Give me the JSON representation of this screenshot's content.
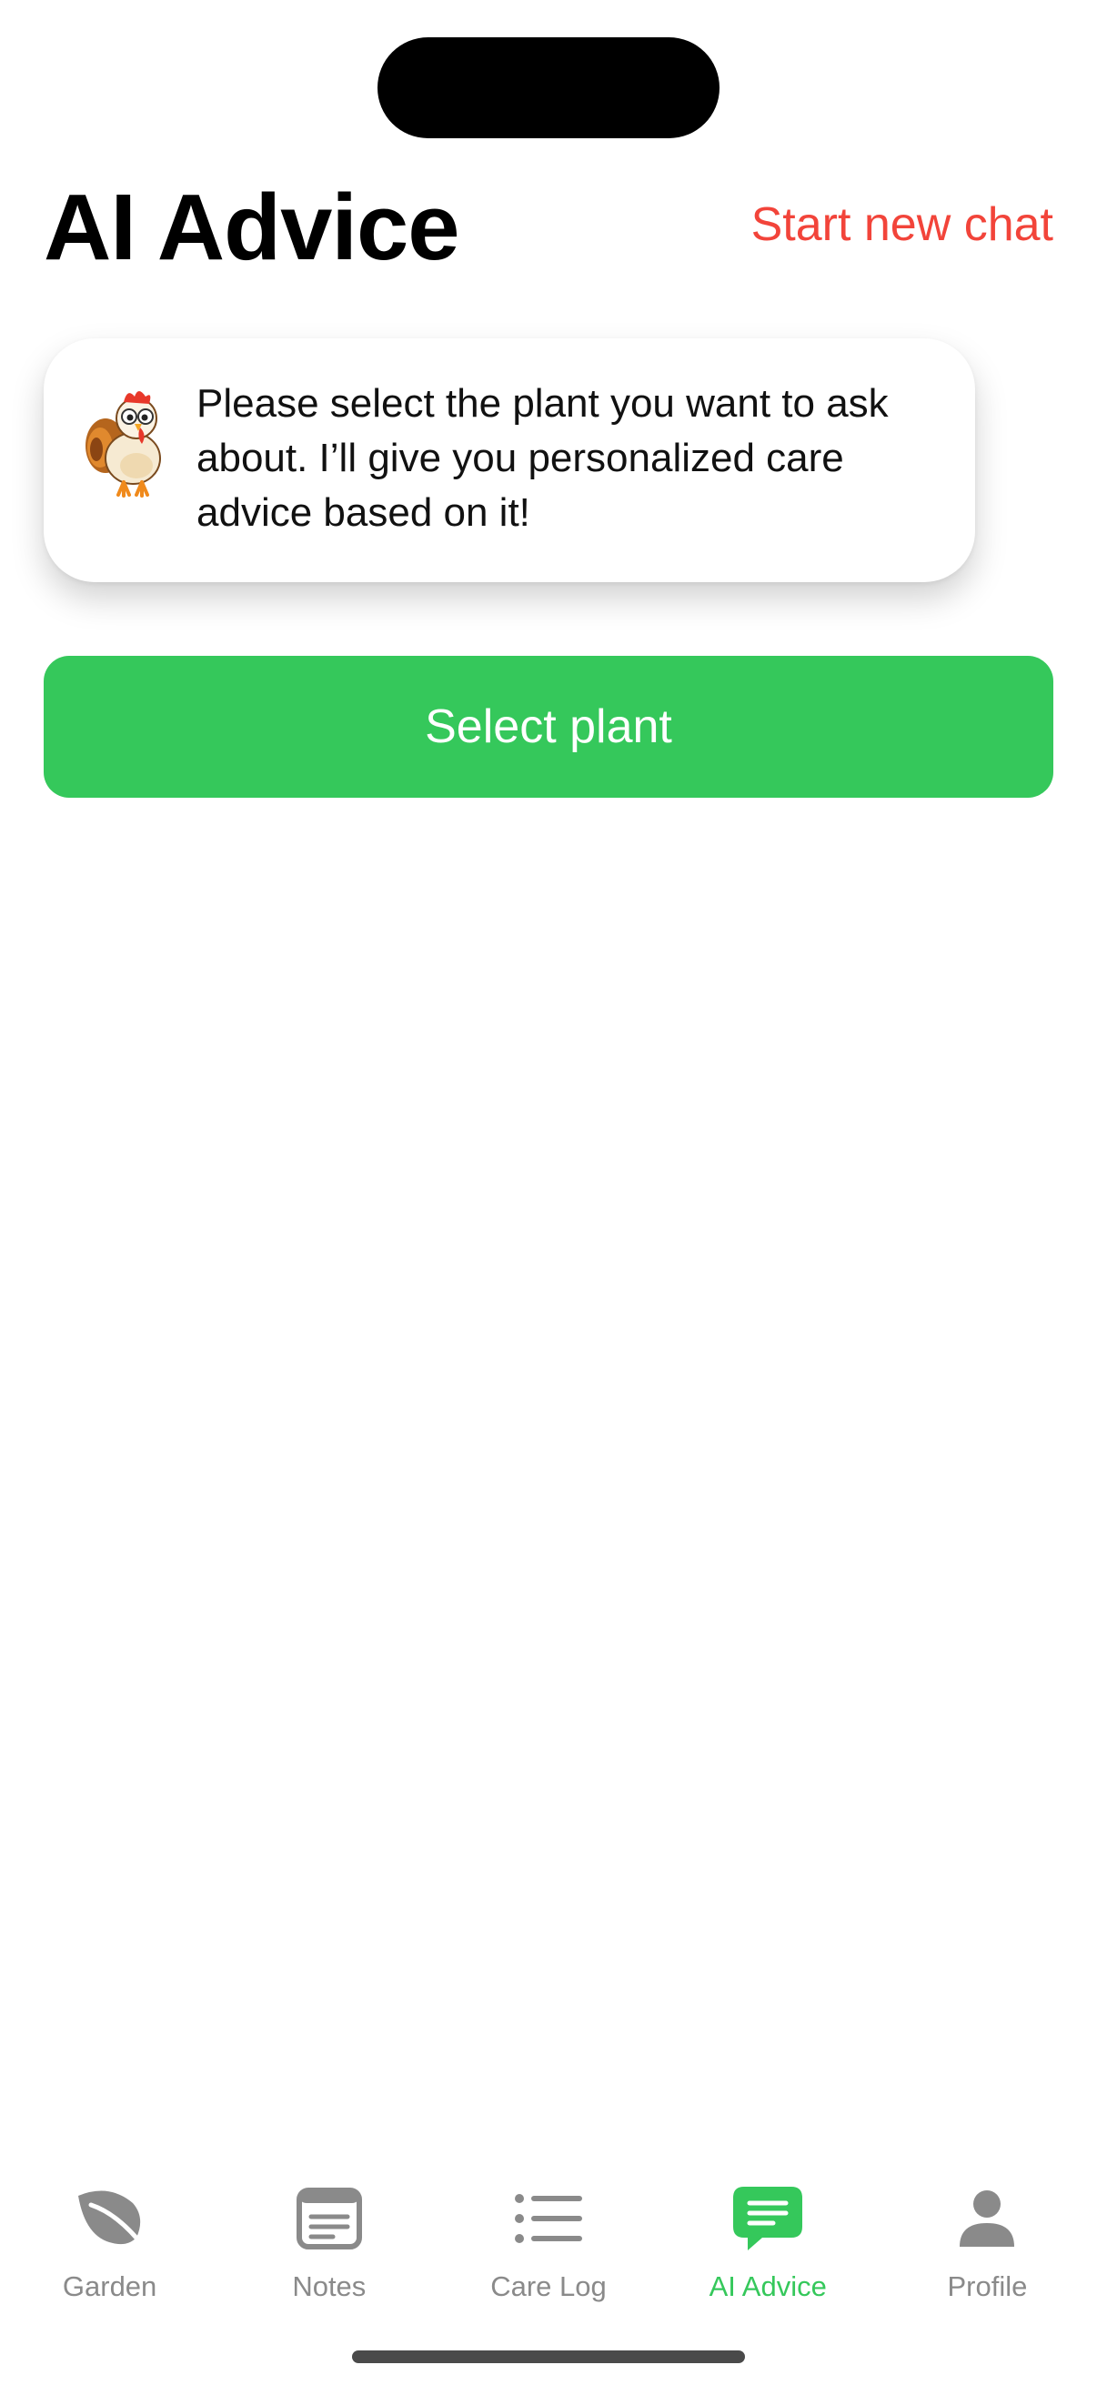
{
  "header": {
    "title": "AI Advice",
    "new_chat_label": "Start new chat"
  },
  "message": {
    "mascot_icon": "turkey-mascot-icon",
    "text": "Please select the plant you want to ask about. I’ll give you personalized care advice based on it!"
  },
  "select_button": {
    "label": "Select plant"
  },
  "tab_bar": {
    "tabs": [
      {
        "label": "Garden",
        "icon": "leaf-icon",
        "active": false
      },
      {
        "label": "Notes",
        "icon": "notes-icon",
        "active": false
      },
      {
        "label": "Care Log",
        "icon": "list-icon",
        "active": false
      },
      {
        "label": "AI Advice",
        "icon": "chat-bubble-icon",
        "active": true
      },
      {
        "label": "Profile",
        "icon": "person-icon",
        "active": false
      }
    ]
  },
  "colors": {
    "accent_green": "#35c85b",
    "link_red": "#f2443a",
    "inactive_gray": "#8a8a8a"
  }
}
